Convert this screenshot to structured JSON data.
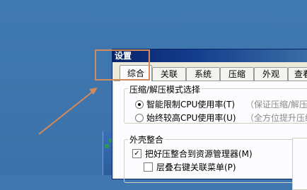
{
  "window": {
    "title": "设置"
  },
  "tabs": [
    {
      "label": "综合",
      "active": true
    },
    {
      "label": "关联",
      "active": false
    },
    {
      "label": "系统",
      "active": false
    },
    {
      "label": "压缩",
      "active": false
    },
    {
      "label": "外观",
      "active": false
    },
    {
      "label": "查看",
      "active": false
    }
  ],
  "compress_mode": {
    "title": "压缩/解压模式选择",
    "options": [
      {
        "label": "智能限制CPU使用率(T)",
        "hint": "（保证压缩/解压与",
        "checked": true
      },
      {
        "label": "始终较高CPU使用率(U)",
        "hint": "（全方位提升压缩",
        "checked": false
      }
    ]
  },
  "shell": {
    "title": "外壳整合",
    "items": [
      {
        "label": "把好压整合到资源管理器(M)",
        "checked": true
      },
      {
        "label": "层叠右键关联菜单(P)",
        "checked": false
      }
    ]
  },
  "colors": {
    "annotation": "#d48a5a",
    "desktop": "#3f76ad"
  }
}
